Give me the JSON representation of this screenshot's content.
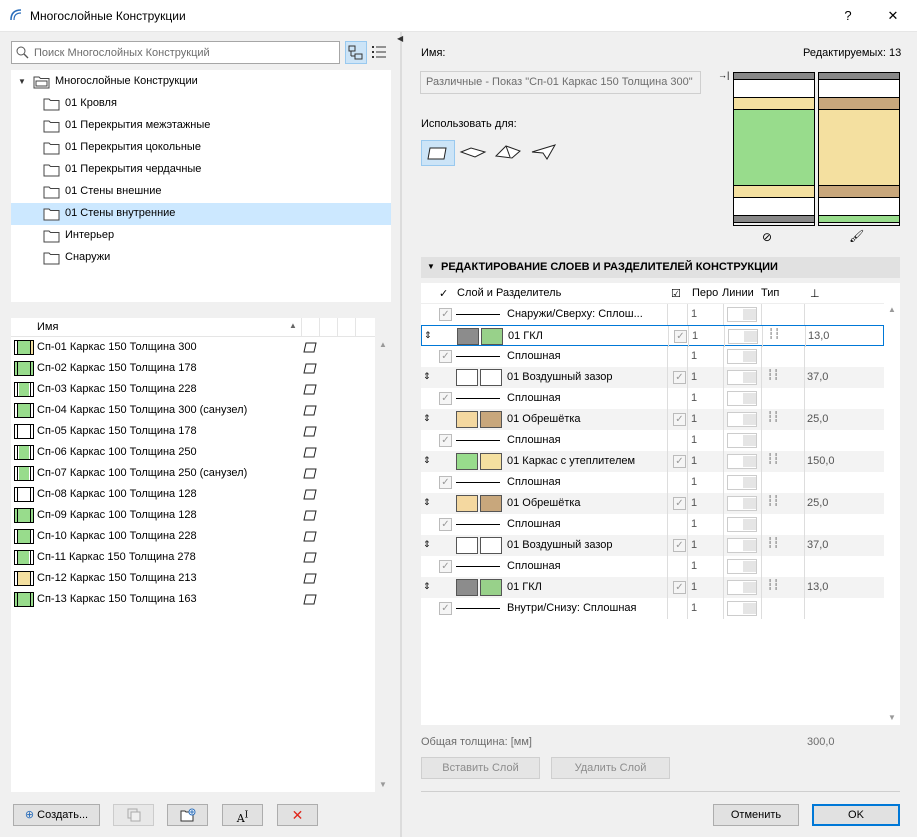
{
  "window": {
    "title": "Многослойные Конструкции",
    "help": "?",
    "close": "✕"
  },
  "search": {
    "placeholder": "Поиск Многослойных Конструкций"
  },
  "tree": {
    "root": "Многослойные Конструкции",
    "items": [
      "01 Кровля",
      "01 Перекрытия межэтажные",
      "01 Перекрытия цокольные",
      "01 Перекрытия чердачные",
      "01 Стены внешние",
      "01 Стены внутренние",
      "Интерьер",
      "Снаружи"
    ],
    "selected_index": 5
  },
  "list": {
    "header": "Имя",
    "rows": [
      "Сп-01 Каркас 150 Толщина 300",
      "Сп-02 Каркас 150 Толщина 178",
      "Сп-03 Каркас 150 Толщина 228",
      "Сп-04 Каркас 150 Толщина 300 (санузел)",
      "Сп-05 Каркас 150 Толщина 178",
      "Сп-06 Каркас 100 Толщина 250",
      "Сп-07 Каркас 100 Толщина 250 (санузел)",
      "Сп-08 Каркас 100 Толщина 128",
      "Сп-09 Каркас 100 Толщина 128",
      "Сп-10 Каркас 100 Толщина 228",
      "Сп-11 Каркас 150 Толщина 278",
      "Сп-12 Каркас 150 Толщина 213",
      "Сп-13 Каркас 150 Толщина 163"
    ]
  },
  "left_buttons": {
    "create": "Создать..."
  },
  "details": {
    "name_label": "Имя:",
    "editable_label": "Редактируемых: 13",
    "name_value": "Различные - Показ \"Сп-01 Каркас 150 Толщина 300\"",
    "use_for_label": "Использовать для:"
  },
  "section": {
    "title": "РЕДАКТИРОВАНИЕ СЛОЕВ И РАЗДЕЛИТЕЛЕЙ КОНСТРУКЦИИ",
    "columns": {
      "layer": "Слой и Разделитель",
      "pen": "Перо",
      "lines": "Линии",
      "type": "Тип"
    },
    "rows": [
      {
        "kind": "sep",
        "name": "Снаружи/Сверху: Сплош...",
        "pen": "1"
      },
      {
        "kind": "layer",
        "name": "01 ГКЛ",
        "pen": "1",
        "thickness": "13,0",
        "c1": "#8c8c8c",
        "c2": "#98d18a",
        "selected": true
      },
      {
        "kind": "sep",
        "name": "Сплошная",
        "pen": "1"
      },
      {
        "kind": "layer",
        "name": "01 Воздушный зазор",
        "pen": "1",
        "thickness": "37,0",
        "c1": "#ffffff",
        "c2": "#ffffff"
      },
      {
        "kind": "sep",
        "name": "Сплошная",
        "pen": "1"
      },
      {
        "kind": "layer",
        "name": "01 Обрешётка",
        "pen": "1",
        "thickness": "25,0",
        "c1": "#f4d8a0",
        "c2": "#c8a77c"
      },
      {
        "kind": "sep",
        "name": "Сплошная",
        "pen": "1"
      },
      {
        "kind": "layer",
        "name": "01 Каркас с утеплителем",
        "pen": "1",
        "thickness": "150,0",
        "c1": "#98dc8c",
        "c2": "#f4e0a0"
      },
      {
        "kind": "sep",
        "name": "Сплошная",
        "pen": "1"
      },
      {
        "kind": "layer",
        "name": "01 Обрешётка",
        "pen": "1",
        "thickness": "25,0",
        "c1": "#f4d8a0",
        "c2": "#c8a77c"
      },
      {
        "kind": "sep",
        "name": "Сплошная",
        "pen": "1"
      },
      {
        "kind": "layer",
        "name": "01 Воздушный зазор",
        "pen": "1",
        "thickness": "37,0",
        "c1": "#ffffff",
        "c2": "#ffffff"
      },
      {
        "kind": "sep",
        "name": "Сплошная",
        "pen": "1"
      },
      {
        "kind": "layer",
        "name": "01 ГКЛ",
        "pen": "1",
        "thickness": "13,0",
        "c1": "#8c8c8c",
        "c2": "#98d18a"
      },
      {
        "kind": "sep",
        "name": "Внутри/Снизу: Сплошная",
        "pen": "1"
      }
    ]
  },
  "footer": {
    "total_label": "Общая толщина: [мм]",
    "total_value": "300,0",
    "insert_layer": "Вставить Слой",
    "delete_layer": "Удалить Слой",
    "cancel": "Отменить",
    "ok": "OK"
  },
  "colors": {
    "accent": "#0078d7",
    "selection": "#cce8ff",
    "green": "#98dc8c",
    "beige": "#f4e0a0",
    "brown": "#c8a77c",
    "gray": "#8c8c8c"
  }
}
